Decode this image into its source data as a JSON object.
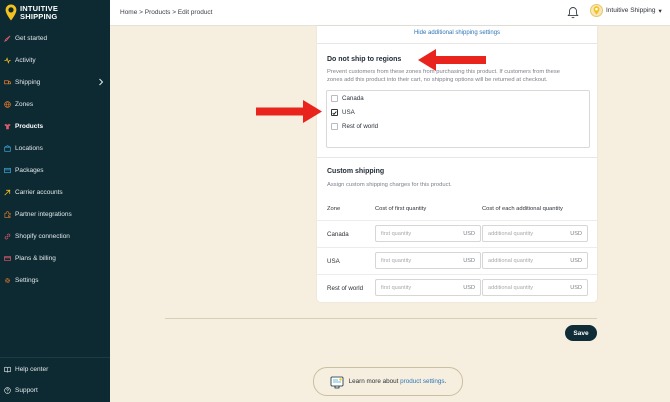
{
  "brand": {
    "line1": "INTUITIVE",
    "line2": "SHIPPING",
    "accent": "#f4c21f"
  },
  "sidebar": {
    "items": [
      {
        "label": "Get started",
        "icon": "rocket-icon"
      },
      {
        "label": "Activity",
        "icon": "activity-icon"
      },
      {
        "label": "Shipping",
        "icon": "truck-icon"
      },
      {
        "label": "Zones",
        "icon": "globe-icon"
      },
      {
        "label": "Products",
        "icon": "shirt-icon"
      },
      {
        "label": "Locations",
        "icon": "location-icon"
      },
      {
        "label": "Packages",
        "icon": "package-icon"
      },
      {
        "label": "Carrier accounts",
        "icon": "carrier-icon"
      },
      {
        "label": "Partner integrations",
        "icon": "puzzle-icon"
      },
      {
        "label": "Shopify connection",
        "icon": "link-icon"
      },
      {
        "label": "Plans & billing",
        "icon": "billing-icon"
      },
      {
        "label": "Settings",
        "icon": "gear-icon"
      }
    ],
    "bottom": [
      {
        "label": "Help center",
        "icon": "book-icon"
      },
      {
        "label": "Support",
        "icon": "help-icon"
      }
    ]
  },
  "header": {
    "breadcrumb": "Home > Products > Edit product",
    "account_name": "Intuitive Shipping",
    "account_caret": "▾"
  },
  "card": {
    "hide_link": "Hide additional shipping settings",
    "no_ship": {
      "title": "Do not ship to regions",
      "desc_line1": "Prevent customers from these zones from purchasing this product. If customers from these",
      "desc_line2": "zones add this product into their cart, no shipping options will be returned at checkout.",
      "regions": [
        {
          "label": "Canada",
          "checked": false
        },
        {
          "label": "USA",
          "checked": true
        },
        {
          "label": "Rest of world",
          "checked": false
        }
      ]
    },
    "custom": {
      "title": "Custom shipping",
      "desc": "Assign custom shipping charges for this product.",
      "col_zone": "Zone",
      "col_first": "Cost of first quantity",
      "col_additional": "Cost of each additional quantity",
      "first_placeholder": "first quantity",
      "additional_placeholder": "additional quantity",
      "unit": "USD",
      "rows": [
        "Canada",
        "USA",
        "Rest of world"
      ]
    }
  },
  "actions": {
    "save_label": "Save"
  },
  "learn_more": {
    "prefix": "Learn more about",
    "link": "product settings",
    "suffix": "."
  },
  "colors": {
    "sidebar_bg": "#0d2a33",
    "page_bg": "#f6efe0",
    "link": "#2d74b5",
    "arrow": "#e8241c"
  }
}
